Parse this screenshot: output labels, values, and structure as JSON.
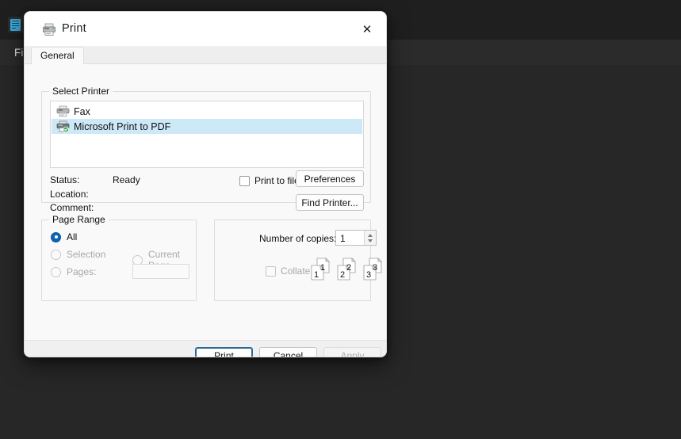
{
  "background": {
    "app_icon": "notepad-icon",
    "menu": {
      "file_label": "File"
    }
  },
  "dialog": {
    "title": "Print",
    "title_icon": "printer-icon",
    "close_icon": "✕",
    "tabs": [
      {
        "label": "General",
        "selected": true
      }
    ],
    "select_printer": {
      "group_label": "Select Printer",
      "printers": [
        {
          "name": "Fax",
          "icon": "printer-icon",
          "selected": false
        },
        {
          "name": "Microsoft Print to PDF",
          "icon": "printer-check-icon",
          "selected": true
        }
      ],
      "status_key": "Status:",
      "status_value": "Ready",
      "location_key": "Location:",
      "location_value": "",
      "comment_key": "Comment:",
      "comment_value": "",
      "print_to_file_label": "Print to file",
      "print_to_file_checked": false,
      "preferences_label": "Preferences",
      "find_printer_label": "Find Printer..."
    },
    "page_range": {
      "group_label": "Page Range",
      "all_label": "All",
      "selection_label": "Selection",
      "current_page_label": "Current Page",
      "pages_label": "Pages:",
      "pages_value": "",
      "selected": "All"
    },
    "copies": {
      "number_of_copies_label": "Number of copies:",
      "copies_value": "1",
      "collate_label": "Collate",
      "collate_checked": false,
      "collate_illustration": [
        "1",
        "1",
        "2",
        "2",
        "3",
        "3"
      ]
    },
    "footer": {
      "print_label": "Print",
      "cancel_label": "Cancel",
      "apply_label": "Apply",
      "apply_enabled": false
    }
  },
  "colors": {
    "selection_blue": "#cde8f6",
    "radio_blue": "#0b64b4",
    "default_button_border": "#2b6a96",
    "dialog_bg": "#f9f9f9",
    "window_bg": "#272727"
  }
}
